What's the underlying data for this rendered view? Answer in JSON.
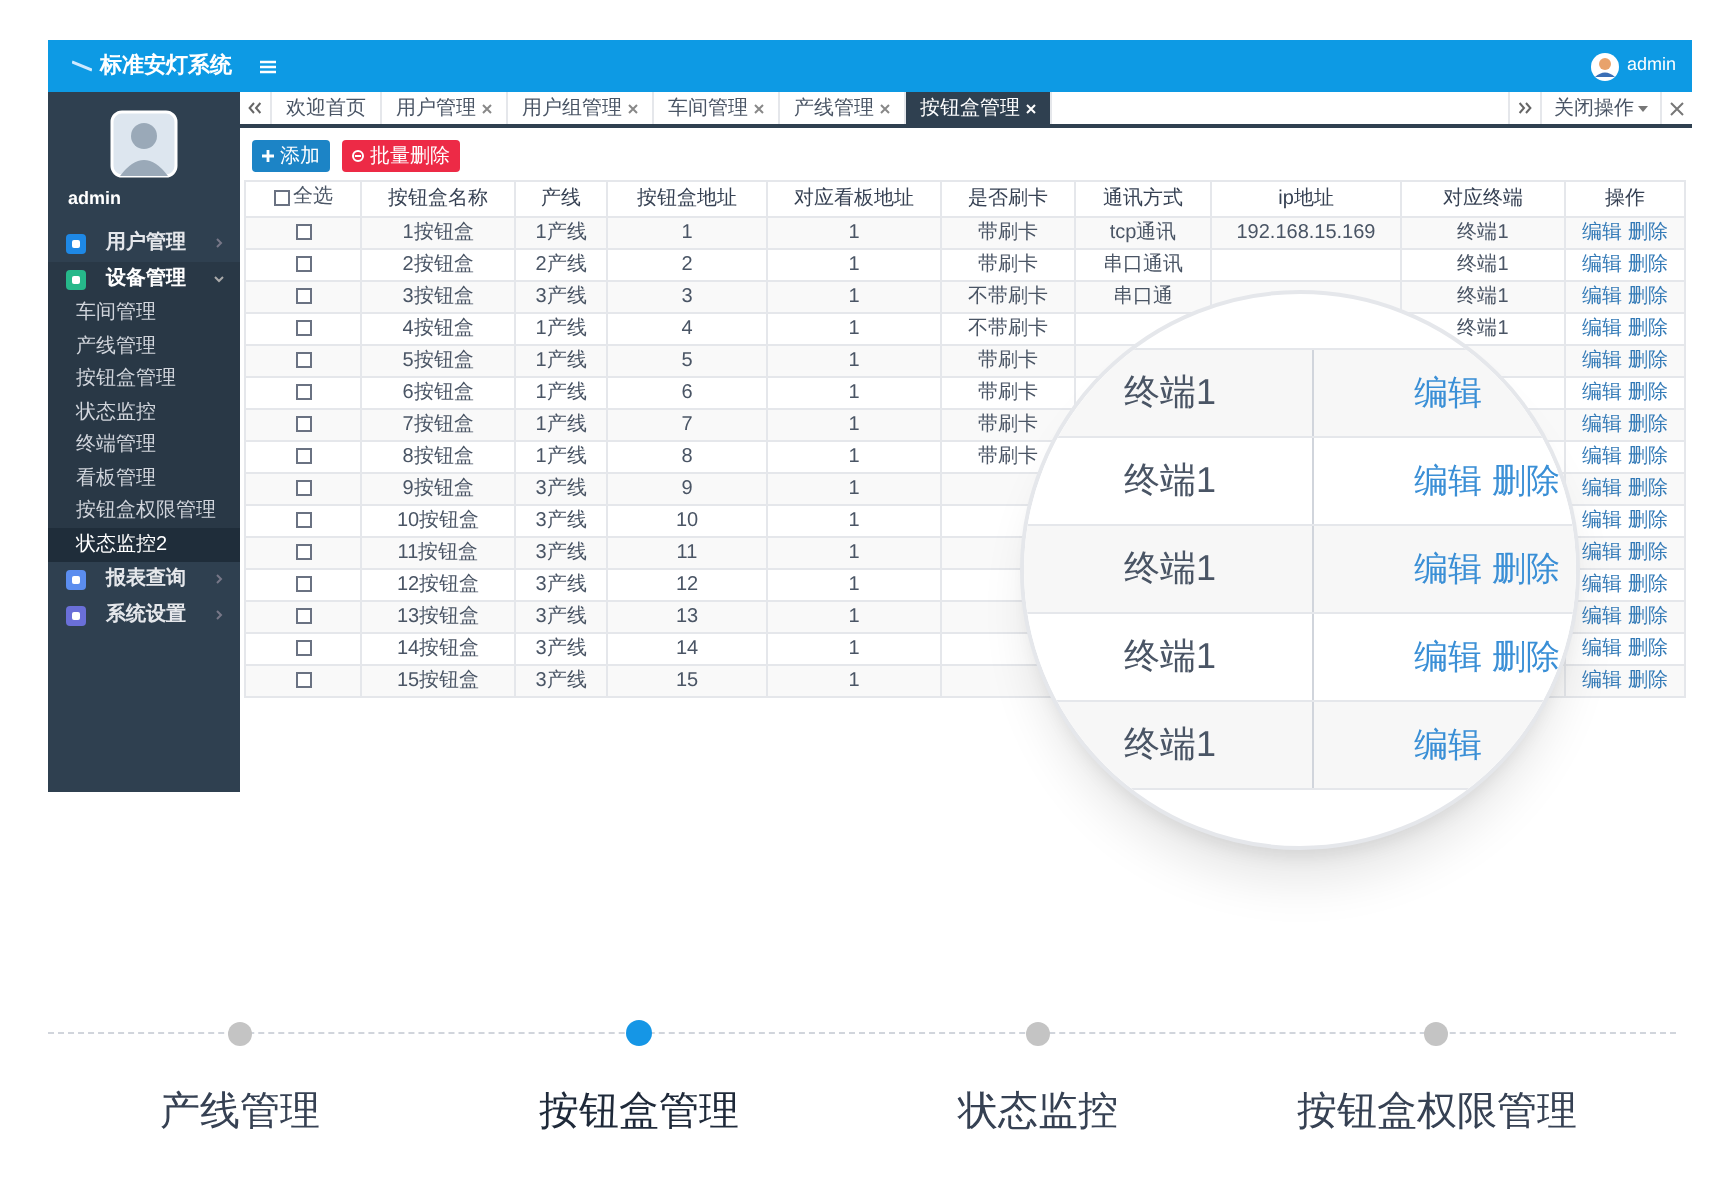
{
  "header": {
    "title": "标准安灯系统",
    "user": "admin"
  },
  "sidebar": {
    "user": "admin",
    "menu": [
      {
        "label": "用户管理",
        "color": "#1e88e5",
        "expanded": false
      },
      {
        "label": "设备管理",
        "color": "#26b88a",
        "expanded": true,
        "children": [
          {
            "label": "车间管理",
            "selected": false
          },
          {
            "label": "产线管理",
            "selected": false
          },
          {
            "label": "按钮盒管理",
            "selected": false
          },
          {
            "label": "状态监控",
            "selected": false
          },
          {
            "label": "终端管理",
            "selected": false
          },
          {
            "label": "看板管理",
            "selected": false
          },
          {
            "label": "按钮盒权限管理",
            "selected": false
          },
          {
            "label": "状态监控2",
            "selected": true
          }
        ]
      },
      {
        "label": "报表查询",
        "color": "#5b8def",
        "expanded": false
      },
      {
        "label": "系统设置",
        "color": "#6a6fd8",
        "expanded": false
      }
    ]
  },
  "tabs": [
    {
      "label": "欢迎首页",
      "closable": false,
      "selected": false
    },
    {
      "label": "用户管理",
      "closable": true,
      "selected": false
    },
    {
      "label": "用户组管理",
      "closable": true,
      "selected": false
    },
    {
      "label": "车间管理",
      "closable": true,
      "selected": false
    },
    {
      "label": "产线管理",
      "closable": true,
      "selected": false
    },
    {
      "label": "按钮盒管理",
      "closable": true,
      "selected": true
    }
  ],
  "tab_actions": {
    "label": "关闭操作"
  },
  "toolbar": [
    {
      "label": "添加",
      "kind": "add"
    },
    {
      "label": "批量删除",
      "kind": "delete"
    }
  ],
  "table": {
    "select_all": {
      "label": "全选",
      "checked": false
    },
    "columns": [
      "按钮盒名称",
      "产线",
      "按钮盒地址",
      "对应看板地址",
      "是否刷卡",
      "通讯方式",
      "ip地址",
      "对应终端",
      "操作"
    ],
    "rows": [
      {
        "checked": false,
        "cells": [
          "1按钮盒",
          "1产线",
          "1",
          "1",
          "带刷卡",
          "tcp通讯",
          "192.168.15.169",
          "终端1"
        ],
        "actions": [
          "编辑",
          "删除"
        ]
      },
      {
        "checked": false,
        "cells": [
          "2按钮盒",
          "2产线",
          "2",
          "1",
          "带刷卡",
          "串口通讯",
          null,
          "终端1"
        ],
        "actions": [
          "编辑",
          "删除"
        ]
      },
      {
        "checked": false,
        "cells": [
          "3按钮盒",
          "3产线",
          "3",
          "1",
          "不带刷卡",
          "串口通",
          null,
          "终端1"
        ],
        "actions": [
          "编辑",
          "删除"
        ]
      },
      {
        "checked": false,
        "cells": [
          "4按钮盒",
          "1产线",
          "4",
          "1",
          "不带刷卡",
          null,
          null,
          "终端1"
        ],
        "actions": [
          "编辑",
          "删除"
        ]
      },
      {
        "checked": false,
        "cells": [
          "5按钮盒",
          "1产线",
          "5",
          "1",
          "带刷卡",
          null,
          null,
          null
        ],
        "actions": [
          "编辑",
          "删除"
        ]
      },
      {
        "checked": false,
        "cells": [
          "6按钮盒",
          "1产线",
          "6",
          "1",
          "带刷卡",
          null,
          null,
          null
        ],
        "actions": [
          "编辑",
          "删除"
        ]
      },
      {
        "checked": false,
        "cells": [
          "7按钮盒",
          "1产线",
          "7",
          "1",
          "带刷卡",
          null,
          null,
          null
        ],
        "actions": [
          "编辑",
          "删除"
        ]
      },
      {
        "checked": false,
        "cells": [
          "8按钮盒",
          "1产线",
          "8",
          "1",
          "带刷卡",
          null,
          null,
          null
        ],
        "actions": [
          "编辑",
          "删除"
        ]
      },
      {
        "checked": false,
        "cells": [
          "9按钮盒",
          "3产线",
          "9",
          "1",
          null,
          null,
          null,
          null
        ],
        "actions": [
          "编辑",
          "删除"
        ]
      },
      {
        "checked": false,
        "cells": [
          "10按钮盒",
          "3产线",
          "10",
          "1",
          null,
          null,
          null,
          null
        ],
        "actions": [
          "编辑",
          "删除"
        ]
      },
      {
        "checked": false,
        "cells": [
          "11按钮盒",
          "3产线",
          "11",
          "1",
          null,
          null,
          null,
          null
        ],
        "actions": [
          "编辑",
          "删除"
        ]
      },
      {
        "checked": false,
        "cells": [
          "12按钮盒",
          "3产线",
          "12",
          "1",
          null,
          null,
          null,
          null
        ],
        "actions": [
          "编辑",
          "删除"
        ]
      },
      {
        "checked": false,
        "cells": [
          "13按钮盒",
          "3产线",
          "13",
          "1",
          null,
          null,
          null,
          null
        ],
        "actions": [
          "编辑",
          "删除"
        ]
      },
      {
        "checked": false,
        "cells": [
          "14按钮盒",
          "3产线",
          "14",
          "1",
          null,
          null,
          null,
          null
        ],
        "actions": [
          "编辑",
          "删除"
        ]
      },
      {
        "checked": false,
        "cells": [
          "15按钮盒",
          "3产线",
          "15",
          "1",
          null,
          null,
          null,
          null
        ],
        "actions": [
          "编辑",
          "删除"
        ]
      }
    ]
  },
  "magnifier": {
    "rows": [
      {
        "terminal": "终端1",
        "actions": [
          "编辑"
        ]
      },
      {
        "terminal": "终端1",
        "actions": [
          "编辑",
          "删除"
        ]
      },
      {
        "terminal": "终端1",
        "actions": [
          "编辑",
          "删除"
        ]
      },
      {
        "terminal": "终端1",
        "actions": [
          "编辑",
          "删除"
        ]
      },
      {
        "terminal": "终端1",
        "actions": [
          "编辑"
        ]
      }
    ]
  },
  "steps": [
    {
      "label": "产线管理",
      "selected": false
    },
    {
      "label": "按钮盒管理",
      "selected": true
    },
    {
      "label": "状态监控",
      "selected": false
    },
    {
      "label": "按钮盒权限管理",
      "selected": false
    }
  ]
}
